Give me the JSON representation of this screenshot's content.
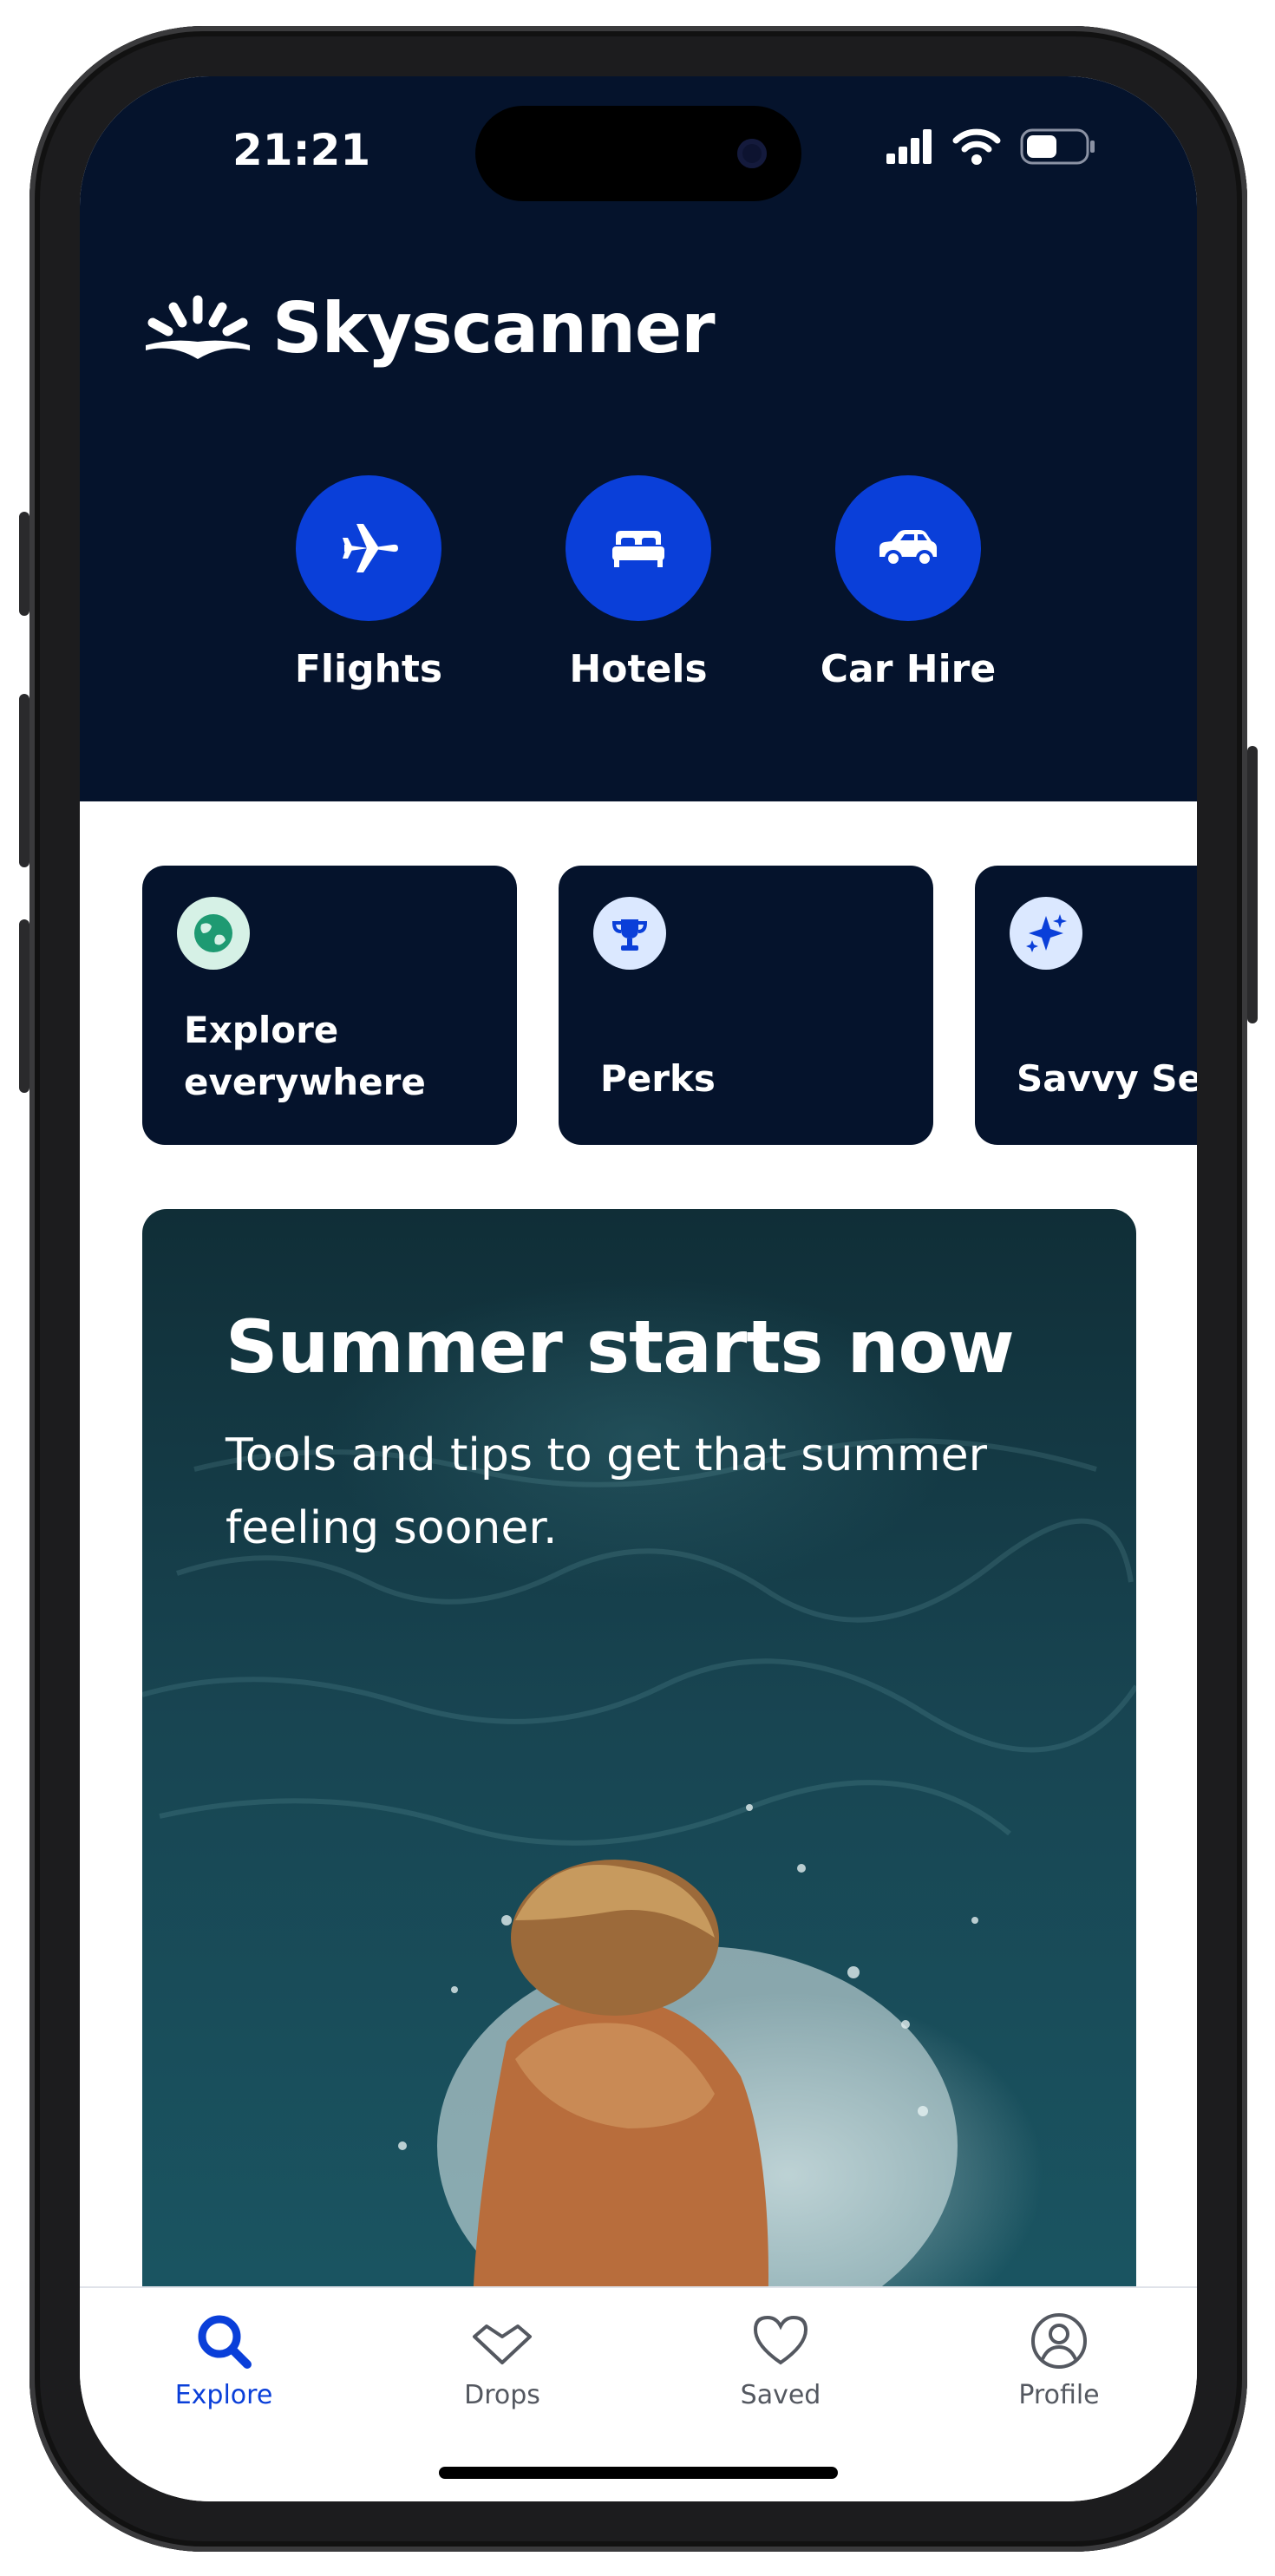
{
  "status_bar": {
    "time": "21:21"
  },
  "header": {
    "brand_name": "Skyscanner"
  },
  "verticals": [
    {
      "label": "Flights",
      "icon": "plane-icon"
    },
    {
      "label": "Hotels",
      "icon": "bed-icon"
    },
    {
      "label": "Car Hire",
      "icon": "car-icon"
    }
  ],
  "cards": [
    {
      "label": "Explore everywhere",
      "icon": "globe-icon"
    },
    {
      "label": "Perks",
      "icon": "trophy-icon"
    },
    {
      "label": "Savvy Sea",
      "icon": "sparkle-icon"
    }
  ],
  "hero": {
    "title": "Summer starts now",
    "subtitle": "Tools and tips to get that summer feeling sooner."
  },
  "tabbar": {
    "items": [
      {
        "label": "Explore",
        "icon": "search-icon",
        "active": true
      },
      {
        "label": "Drops",
        "icon": "drops-icon",
        "active": false
      },
      {
        "label": "Saved",
        "icon": "heart-icon",
        "active": false
      },
      {
        "label": "Profile",
        "icon": "profile-icon",
        "active": false
      }
    ]
  },
  "colors": {
    "header_bg": "#05132c",
    "brand_blue": "#0a3fd9",
    "card_bg": "#05132c",
    "tab_active": "#0a3fd9",
    "tab_inactive": "#545860"
  }
}
